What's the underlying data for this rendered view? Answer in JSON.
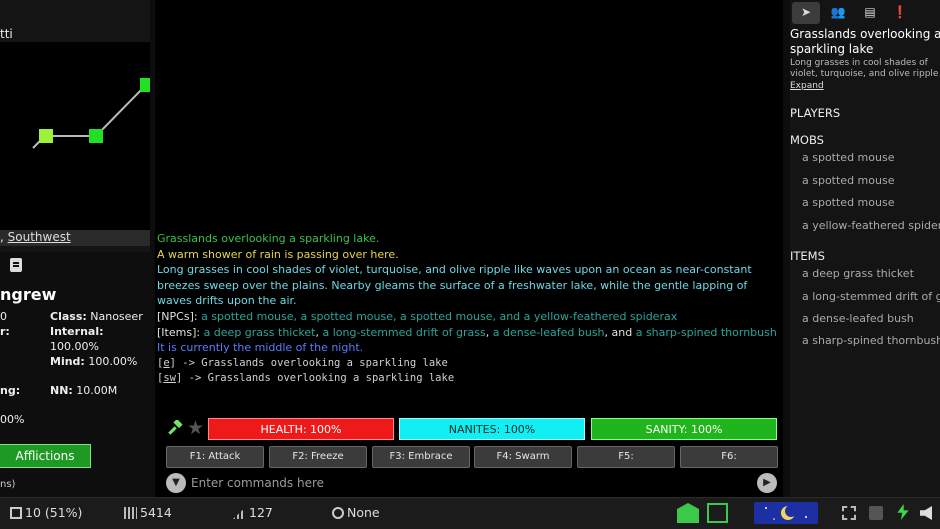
{
  "left": {
    "area_title": "tti",
    "exits": {
      "prefix": ", ",
      "link": "Southwest"
    },
    "char_name": "ngrew",
    "stats": [
      {
        "label": "",
        "value": "0"
      },
      {
        "label": "Class:",
        "value": " Nanoseer"
      },
      {
        "label": "r:",
        "value": ""
      },
      {
        "label": "Internal:",
        "value": ""
      },
      {
        "label": "",
        "value": "100.00%"
      },
      {
        "label": "Mind:",
        "value": " 100.00%"
      },
      {
        "label": "ng:",
        "value": ""
      },
      {
        "label": "NN:",
        "value": " 10.00M"
      },
      {
        "label": "",
        "value": "00%"
      }
    ],
    "afflictions_label": "Afflictions",
    "footer_text": "ns)"
  },
  "log": {
    "room_title": "Grasslands overlooking a sparkling lake.",
    "weather": "A warm shower of rain is passing over here.",
    "description": "Long grasses in cool shades of violet, turquoise, and olive ripple like waves upon an ocean as near-constant breezes sweep over the plains. Nearby gleams the surface of a freshwater lake, while the gentle lapping of waves drifts upon the air.",
    "npcs_label": "[NPCs]:",
    "npcs": "a spotted mouse, a spotted mouse, a spotted mouse, and a yellow-feathered spiderax",
    "items_label": "[Items]:",
    "items": [
      "a deep grass thicket",
      "a long-stemmed drift of grass",
      "a dense-leafed bush",
      "a sharp-spined thornbush"
    ],
    "items_sep1": ", ",
    "items_sep2": ", ",
    "items_and": ", and ",
    "time": "It is currently the middle of the night.",
    "exit_lines": [
      {
        "dir": "e",
        "text": " -> Grasslands overlooking a sparkling lake"
      },
      {
        "dir": "sw",
        "text": " -> Grasslands overlooking a sparkling lake"
      }
    ]
  },
  "vitals": {
    "health": "HEALTH: 100%",
    "nanites": "NANITES: 100%",
    "sanity": "SANITY: 100%",
    "health_color": "#ee1a1a",
    "nanites_color": "#11eff2",
    "sanity_color": "#20b51c"
  },
  "fkeys": [
    "F1: Attack",
    "F2: Freeze",
    "F3: Embrace",
    "F4: Swarm",
    "F5:",
    "F6:"
  ],
  "command": {
    "placeholder": "Enter commands here",
    "value": ""
  },
  "right": {
    "room_name": "Grasslands overlooking a sparkling lake",
    "room_desc": "Long grasses in cool shades of violet, turquoise, and olive ripple like waves",
    "expand": "Expand",
    "players_header": "PLAYERS",
    "mobs_header": "MOBS",
    "mobs": [
      "a spotted mouse",
      "a spotted mouse",
      "a spotted mouse",
      "a yellow-feathered spiderax"
    ],
    "items_header": "ITEMS",
    "items": [
      "a deep grass thicket",
      "a long-stemmed drift of grass",
      "a dense-leafed bush",
      "a sharp-spined thornbush"
    ]
  },
  "bottom": {
    "level": "10 (51%)",
    "gold": "5414",
    "ping": "127",
    "target": "None"
  },
  "icons": {
    "hammer": "hammer-icon",
    "star": "star-icon",
    "send": "send-icon",
    "menu": "chevron-down-icon"
  }
}
